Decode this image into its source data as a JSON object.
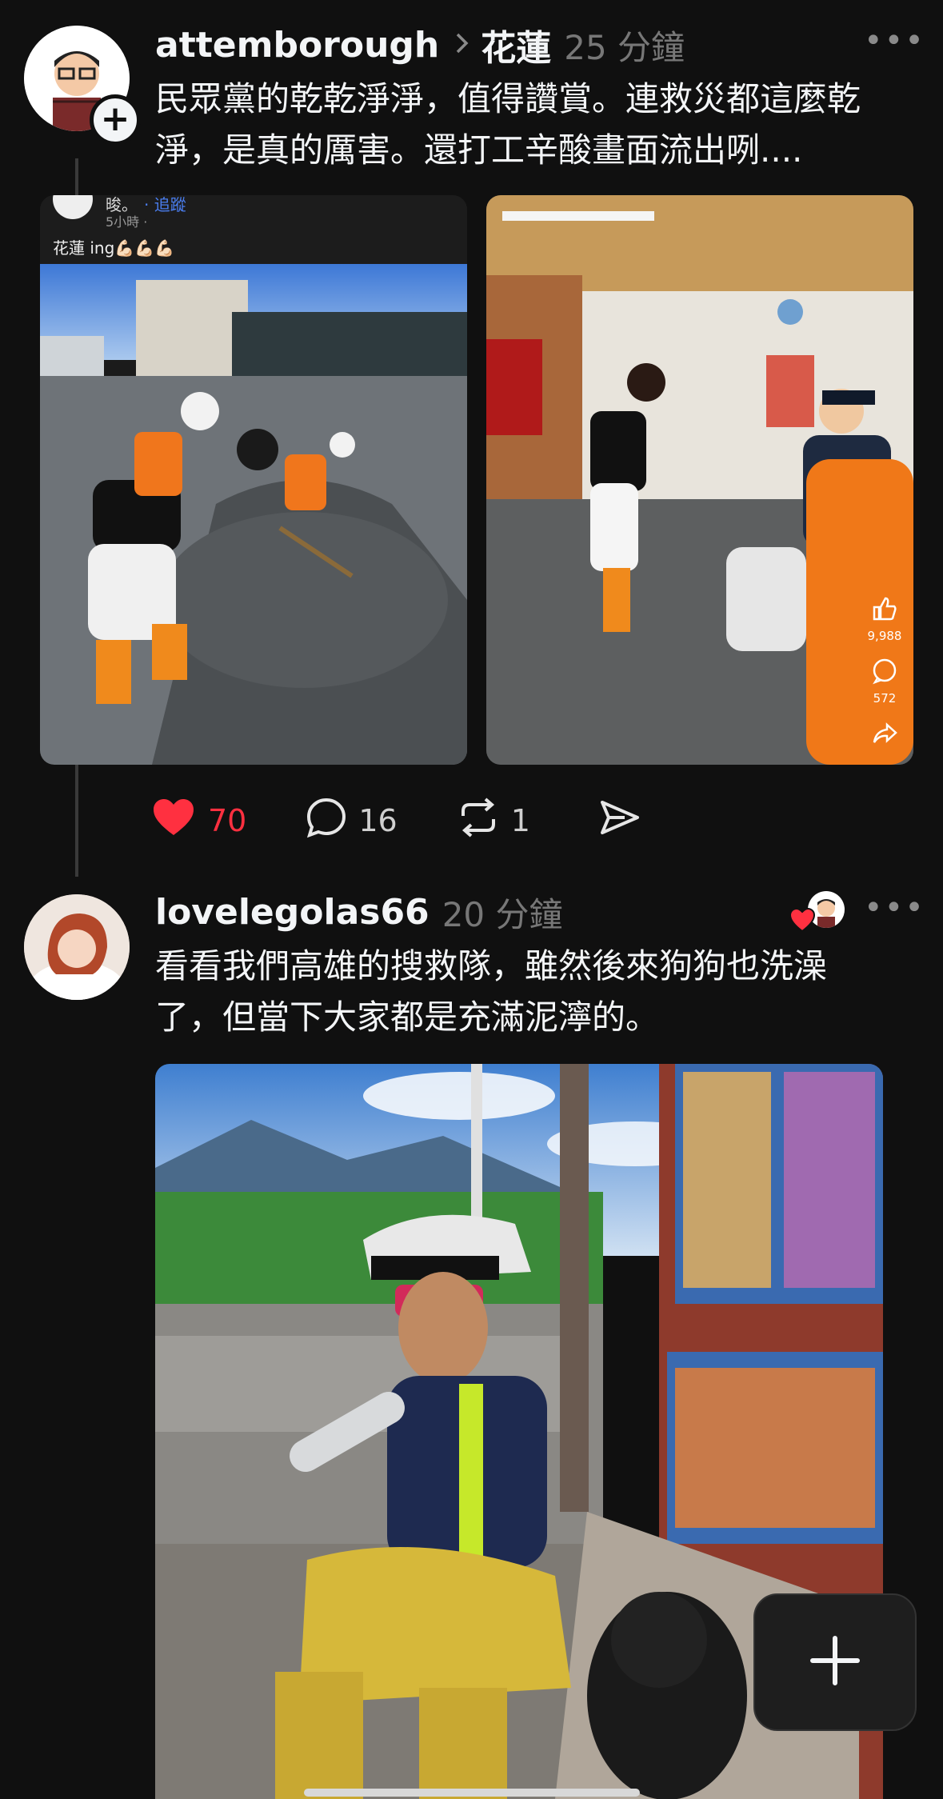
{
  "post1": {
    "username": "attemborough",
    "topic": "花蓮",
    "time": "25 分鐘",
    "text_line1": "民眾黨的乾乾淨淨，值得讚賞。連救災都這麼乾",
    "text_line2": "淨，是真的厲害。還打工辛酸畫面流出咧....",
    "media1": {
      "name": "晙。",
      "follow": "· 追蹤",
      "time": "5小時 ·",
      "caption": "花蓮 ing💪🏻💪🏻💪🏻"
    },
    "media2": {
      "likes": "9,988",
      "comments": "572"
    },
    "actions": {
      "likes": "70",
      "replies": "16",
      "reposts": "1"
    }
  },
  "post2": {
    "username": "lovelegolas66",
    "time": "20 分鐘",
    "text_line1": "看看我們高雄的搜救隊，雖然後來狗狗也洗澡",
    "text_line2": "了，但當下大家都是充滿泥濘的。"
  },
  "colors": {
    "background": "#101010",
    "like_red": "#ff3040",
    "text": "#f3f5f7",
    "muted": "#777777"
  }
}
